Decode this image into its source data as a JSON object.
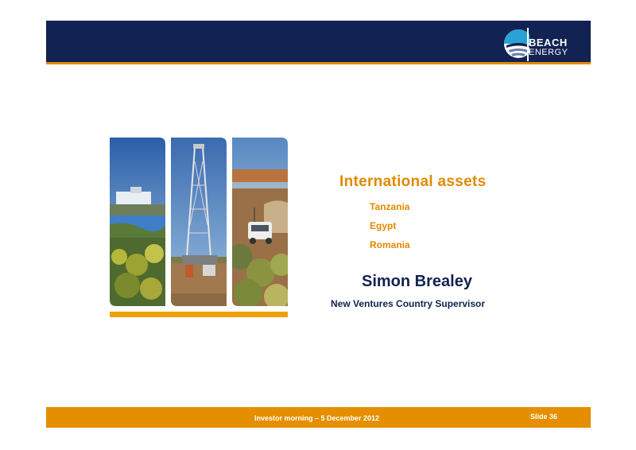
{
  "header": {
    "logo": {
      "line1": "BEACH",
      "line2": "ENERGY"
    }
  },
  "content": {
    "subtitle": "International assets",
    "assets": [
      "Tanzania",
      "Egypt",
      "Romania"
    ],
    "presenter_name": "Simon Brealey",
    "presenter_role": "New Ventures Country Supervisor"
  },
  "footer": {
    "event": "Investor morning – 5 December 2012",
    "slide_number": "Slide 36"
  },
  "colors": {
    "navy": "#122252",
    "orange": "#e08a00",
    "logo_cyan": "#29a3d4"
  },
  "photos": [
    "gas-plant-photo",
    "drilling-rig-photo",
    "field-vehicle-photo"
  ]
}
